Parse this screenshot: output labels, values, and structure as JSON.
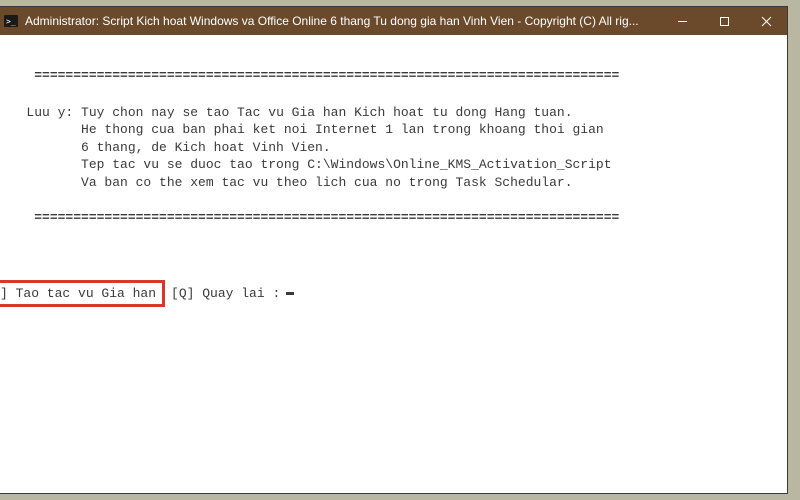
{
  "window": {
    "title": "Administrator:  Script Kich hoat Windows va Office Online 6 thang Tu dong gia han Vinh Vien - Copyright (C) All rig...",
    "controls": {
      "minimize": "Minimize",
      "maximize": "Maximize",
      "close": "Close"
    }
  },
  "console": {
    "divider": "===========================================================================",
    "note_label": "Luu y:",
    "note_lines": [
      "Tuy chon nay se tao Tac vu Gia han Kich hoat tu dong Hang tuan.",
      "He thong cua ban phai ket noi Internet 1 lan trong khoang thoi gian",
      "6 thang, de Kich hoat Vinh Vien.",
      "Tep tac vu se duoc tao trong C:\\Windows\\Online_KMS_Activation_Script",
      "Va ban co the xem tac vu theo lich cua no trong Task Schedular."
    ],
    "prompt": {
      "highlighted": "] Tao tac vu Gia han",
      "rest": "[Q] Quay lai :"
    }
  }
}
